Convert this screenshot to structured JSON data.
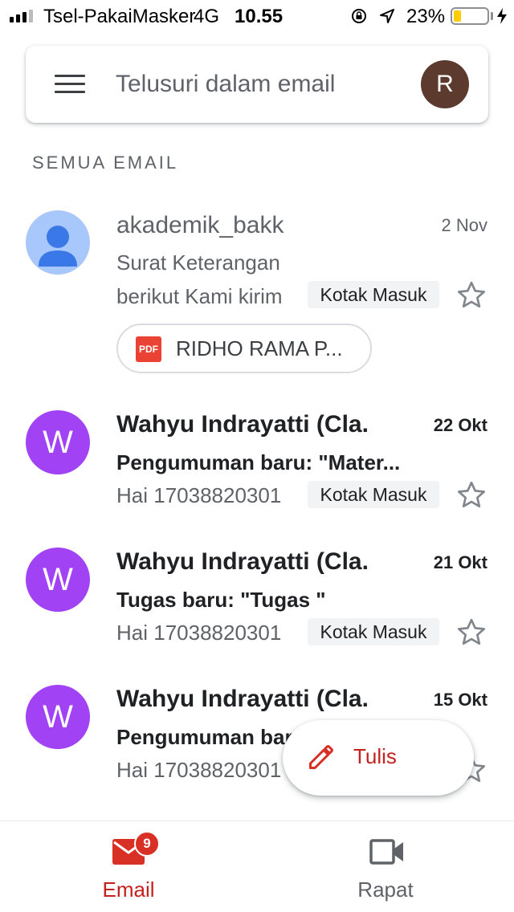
{
  "status_bar": {
    "carrier": "Tsel-PakaiMasker",
    "network": "4G",
    "time": "10.55",
    "battery_percent": "23%",
    "battery_level": 0.23,
    "icons": [
      "signal-icon",
      "orientation-lock-icon",
      "location-icon",
      "battery-icon",
      "charging-icon"
    ]
  },
  "search": {
    "placeholder": "Telusuri dalam email",
    "value": "",
    "avatar_initial": "R",
    "avatar_color": "#5d3a2e"
  },
  "section_label": "SEMUA EMAIL",
  "emails": [
    {
      "sender": "akademik_bakk",
      "date": "2 Nov",
      "subject": "Surat Keterangan",
      "snippet": "berikut Kami kirim",
      "label": "Kotak Masuk",
      "attachment": "RIDHO RAMA P...",
      "attachment_type": "PDF",
      "unread": false,
      "starred": false,
      "avatar": "default-person-icon",
      "avatar_color": "#8ab4f8"
    },
    {
      "sender": "Wahyu Indrayatti (Cla.",
      "date": "22 Okt",
      "subject": "Pengumuman baru: \"Mater...",
      "snippet": "Hai 17038820301",
      "label": "Kotak Masuk",
      "unread": true,
      "starred": false,
      "avatar_initial": "W",
      "avatar_color": "#a142f4"
    },
    {
      "sender": "Wahyu Indrayatti (Cla.",
      "date": "21 Okt",
      "subject": "Tugas baru: \"Tugas \"",
      "snippet": "Hai 17038820301",
      "label": "Kotak Masuk",
      "unread": true,
      "starred": false,
      "avatar_initial": "W",
      "avatar_color": "#a142f4"
    },
    {
      "sender": "Wahyu Indrayatti (Cla.",
      "date": "15 Okt",
      "subject": "Pengumuman baru",
      "snippet": "Hai 17038820301",
      "unread": true,
      "starred": false,
      "avatar_initial": "W",
      "avatar_color": "#a142f4"
    }
  ],
  "compose": {
    "label": "Tulis",
    "icon": "pencil-icon"
  },
  "bottom_nav": [
    {
      "label": "Email",
      "icon": "mail-icon",
      "badge": "9",
      "active": true
    },
    {
      "label": "Rapat",
      "icon": "video-icon",
      "active": false
    }
  ],
  "colors": {
    "accent_red": "#c5221f",
    "badge_red": "#d93025",
    "label_chip_bg": "#f1f3f4",
    "secondary_text": "#5f6368"
  }
}
